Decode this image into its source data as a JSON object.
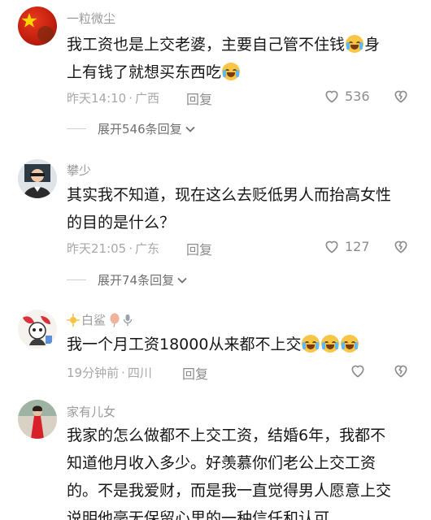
{
  "comments": [
    {
      "username": "一粒微尘",
      "text_lines": [
        "我工资也是上交老婆，主要自己管不住钱",
        "身",
        "上有钱了就想买东西吃"
      ],
      "time": "昨天14:10",
      "location": "广西",
      "reply_label": "回复",
      "likes": "536",
      "expand_label": "展开546条回复"
    },
    {
      "username": "攀少",
      "text_lines": [
        "其实我不知道，现在这么去贬低男人而抬高女性",
        "的目的是什么？"
      ],
      "time": "昨天21:05",
      "location": "广东",
      "reply_label": "回复",
      "likes": "127",
      "expand_label": "展开74条回复"
    },
    {
      "username": "白鲨",
      "text_lines": [
        "我一个月工资18000从来都不上交"
      ],
      "time": "19分钟前",
      "location": "四川",
      "reply_label": "回复",
      "likes": ""
    },
    {
      "username": "家有儿女",
      "text_lines": [
        "我家的怎么做都不上交工资，结婚6年，我都不",
        "知道他月收入多少。好羡慕你们老公上交工资",
        "的。不是我爱财，而是我一直觉得男人愿意上交",
        "说明他毫无保留心里的一种信任和认可"
      ]
    }
  ],
  "separator": "·",
  "icons": {
    "like": "heart-outline-icon",
    "dislike": "broken-heart-icon",
    "expand_chevron": "chevron-down-icon",
    "emoji": "laughing-crying-emoji"
  },
  "colors": {
    "text": "#161616",
    "username": "#9a9a9a",
    "meta": "#a8a8a8",
    "background": "#ffffff"
  }
}
